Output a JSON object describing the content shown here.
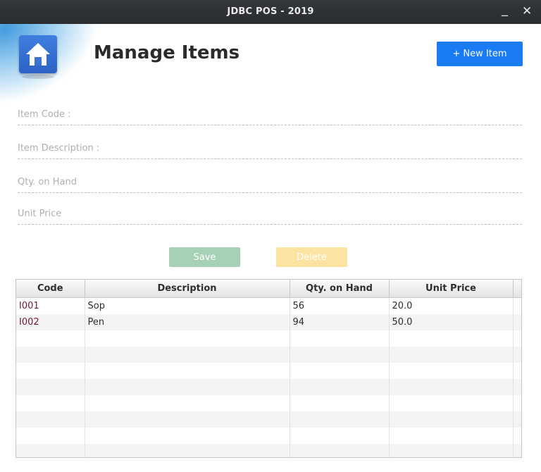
{
  "window": {
    "title": "JDBC POS - 2019",
    "minimize_glyph": "_",
    "close_glyph": "✕"
  },
  "header": {
    "icon": "home-icon",
    "title": "Manage Items",
    "new_item_label": "+ New Item"
  },
  "form": {
    "fields": [
      {
        "label": "Item Code :",
        "value": ""
      },
      {
        "label": "Item Description :",
        "value": ""
      },
      {
        "label": "Qty. on Hand",
        "value": ""
      },
      {
        "label": "Unit Price",
        "value": ""
      }
    ],
    "save_label": "Save",
    "delete_label": "Delete"
  },
  "table": {
    "columns": [
      "Code",
      "Description",
      "Qty. on Hand",
      "Unit Price"
    ],
    "rows": [
      [
        "I001",
        "Sop",
        "56",
        "20.0"
      ],
      [
        "I002",
        "Pen",
        "94",
        "50.0"
      ]
    ]
  },
  "colors": {
    "accent": "#1a7cf5",
    "save_button": "#a7d1b4",
    "delete_button": "#fce3a1",
    "code_text": "#7a1a3a"
  }
}
